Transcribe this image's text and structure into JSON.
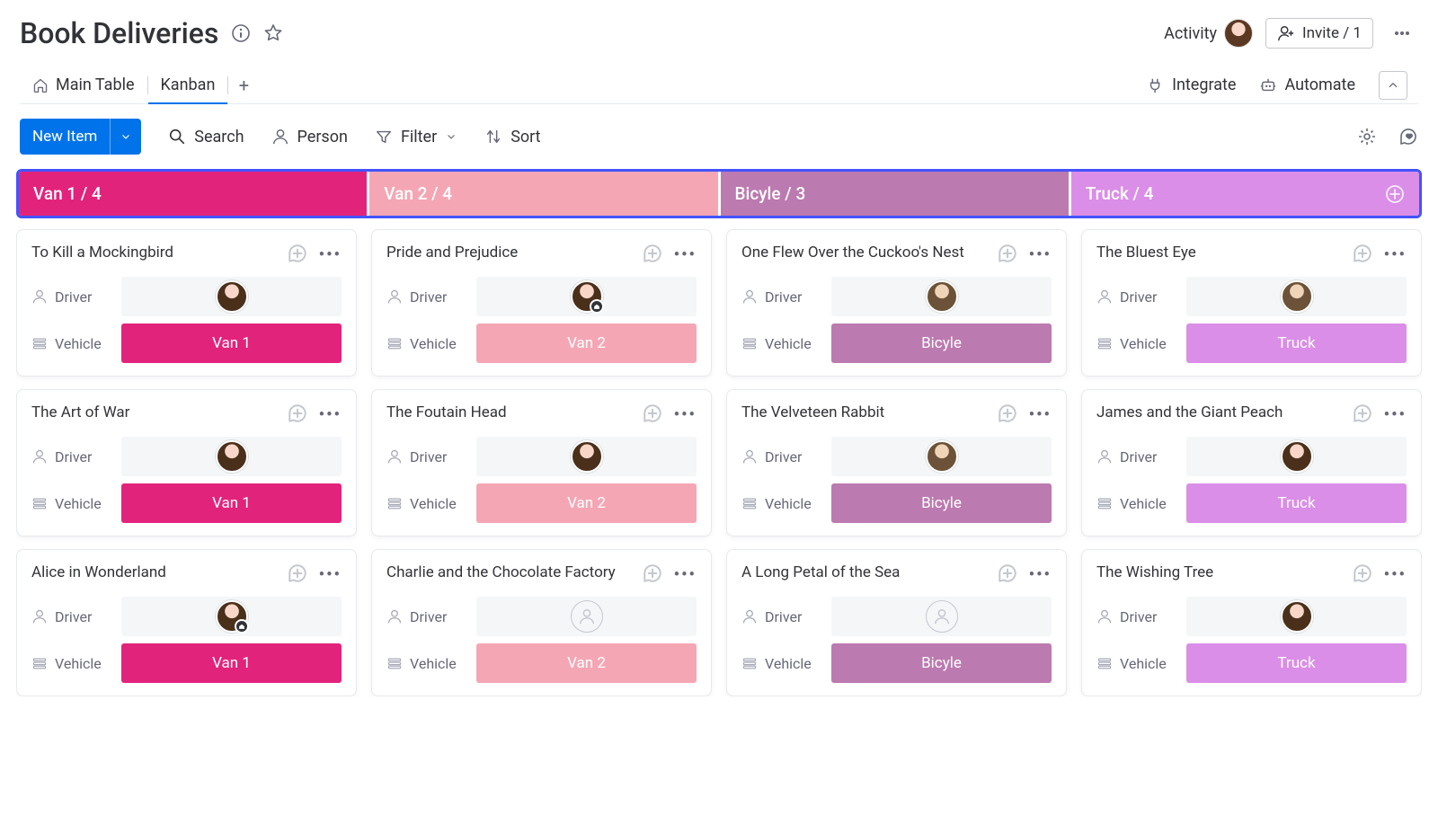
{
  "header": {
    "title": "Book Deliveries",
    "activity_label": "Activity",
    "invite_label": "Invite / 1"
  },
  "tabs": {
    "main_table": "Main Table",
    "kanban": "Kanban",
    "integrate": "Integrate",
    "automate": "Automate"
  },
  "toolbar": {
    "new_item": "New Item",
    "search": "Search",
    "person": "Person",
    "filter": "Filter",
    "sort": "Sort"
  },
  "field_labels": {
    "driver": "Driver",
    "vehicle": "Vehicle"
  },
  "columns": [
    {
      "header": "Van 1 / 4",
      "color": "#e2237c",
      "badge_color": "#e2237c",
      "cards": [
        {
          "title": "To Kill a Mockingbird",
          "driver": "brown",
          "badge": false,
          "vehicle": "Van 1"
        },
        {
          "title": "The Art of War",
          "driver": "brown",
          "badge": false,
          "vehicle": "Van 1"
        },
        {
          "title": "Alice in Wonderland",
          "driver": "brown",
          "badge": true,
          "vehicle": "Van 1"
        }
      ]
    },
    {
      "header": "Van 2 / 4",
      "color": "#f5a6b4",
      "badge_color": "#f5a6b4",
      "cards": [
        {
          "title": "Pride and Prejudice",
          "driver": "brown",
          "badge": true,
          "vehicle": "Van 2"
        },
        {
          "title": "The Foutain Head",
          "driver": "brown",
          "badge": false,
          "vehicle": "Van 2"
        },
        {
          "title": "Charlie and the Chocolate Factory",
          "driver": "empty",
          "badge": false,
          "vehicle": "Van 2"
        }
      ]
    },
    {
      "header": "Bicyle / 3",
      "color": "#bb7ab0",
      "badge_color": "#bb7ab0",
      "cards": [
        {
          "title": "One Flew Over the Cuckoo's Nest",
          "driver": "green",
          "badge": false,
          "vehicle": "Bicyle"
        },
        {
          "title": "The Velveteen Rabbit",
          "driver": "green",
          "badge": false,
          "vehicle": "Bicyle"
        },
        {
          "title": "A Long Petal of the Sea",
          "driver": "empty",
          "badge": false,
          "vehicle": "Bicyle"
        }
      ]
    },
    {
      "header": "Truck / 4",
      "color": "#da8ee7",
      "badge_color": "#da8ee7",
      "cards": [
        {
          "title": "The Bluest Eye",
          "driver": "green",
          "badge": false,
          "vehicle": "Truck"
        },
        {
          "title": "James and the Giant Peach",
          "driver": "brown",
          "badge": false,
          "vehicle": "Truck"
        },
        {
          "title": "The Wishing Tree",
          "driver": "brown",
          "badge": false,
          "vehicle": "Truck"
        }
      ]
    }
  ]
}
